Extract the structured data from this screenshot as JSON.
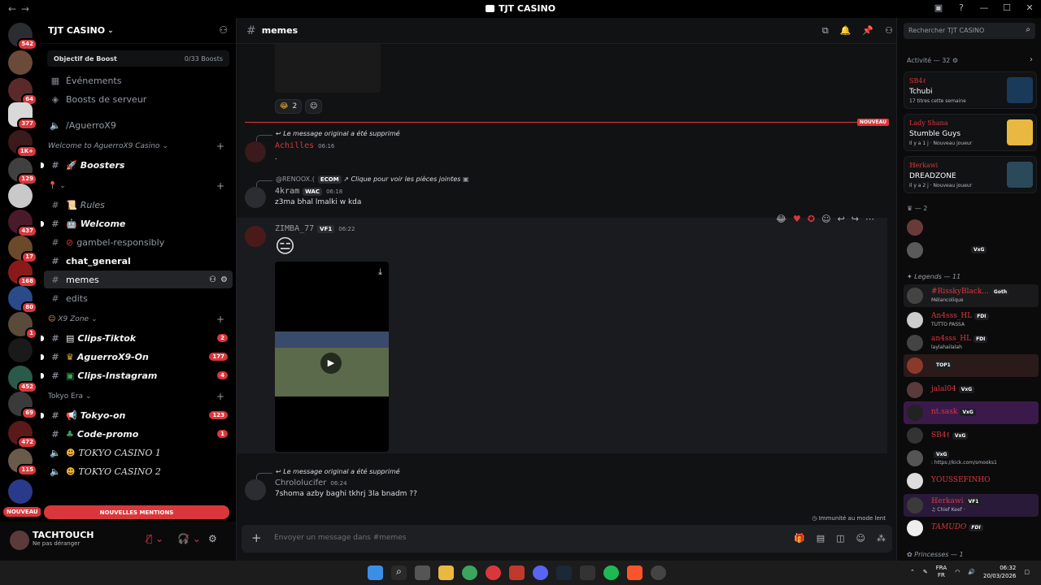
{
  "window": {
    "title": "TJT CASINO"
  },
  "rail": {
    "badges": [
      "542",
      "64",
      "377",
      "1K+",
      "129",
      "437",
      "17",
      "168",
      "80",
      "1",
      "452",
      "69",
      "472",
      "115"
    ],
    "new_label": "NOUVEAU"
  },
  "guild": {
    "name": "TJT CASINO",
    "boost_goal": "Objectif de Boost",
    "boost_count": "0/33 Boosts",
    "events": "Événements",
    "server_boosts": "Boosts de serveur",
    "channels": [
      {
        "label": "/AguerroX9",
        "kind": "voice"
      },
      {
        "label": "Welcome to AguerroX9 Casino",
        "kind": "category"
      },
      {
        "label": "Boosters",
        "kind": "text",
        "unread": true,
        "italic": true
      },
      {
        "label": "",
        "kind": "category"
      },
      {
        "label": "Rules",
        "kind": "text",
        "italic": true
      },
      {
        "label": "Welcome",
        "kind": "text",
        "unread": true,
        "italic": true
      },
      {
        "label": "gambel-responsibly",
        "kind": "text"
      },
      {
        "label": "chat_general",
        "kind": "text",
        "unread": true
      },
      {
        "label": "memes",
        "kind": "text",
        "active": true
      },
      {
        "label": "edits",
        "kind": "text"
      },
      {
        "label": "X9 Zone",
        "kind": "category"
      },
      {
        "label": "Clips-Tiktok",
        "kind": "text",
        "unread": true,
        "italic": true,
        "badge": "2"
      },
      {
        "label": "AguerroX9-On",
        "kind": "text",
        "unread": true,
        "italic": true,
        "badge": "177"
      },
      {
        "label": "Clips-Instagram",
        "kind": "text",
        "unread": true,
        "italic": true,
        "badge": "4"
      },
      {
        "label": "Tokyo Era",
        "kind": "category"
      },
      {
        "label": "Tokyo-on",
        "kind": "text",
        "unread": true,
        "italic": true,
        "badge": "123"
      },
      {
        "label": "Code-promo",
        "kind": "text",
        "unread": true,
        "italic": true,
        "badge": "1"
      },
      {
        "label": "TOKYO CASINO 1",
        "kind": "voice"
      },
      {
        "label": "TOKYO CASINO 2",
        "kind": "voice"
      }
    ],
    "mentions_label": "NOUVELLES MENTIONS"
  },
  "user": {
    "name": "TACHTOUCH",
    "status": "Ne pas déranger"
  },
  "channel": {
    "name": "memes",
    "search_placeholder": "Rechercher TJT CASINO",
    "composer_placeholder": "Envoyer un message dans #memes",
    "slow_mode": "Immunité au mode lent",
    "new_label": "NOUVEAU"
  },
  "messages": [
    {
      "reply": "Le message original a été supprimé",
      "author": "Achilles",
      "time": "06:16",
      "text": "."
    },
    {
      "reply_author": "@RENOOX.(",
      "reply_tag": "ECOM",
      "reply": "Clique pour voir les pièces jointes",
      "author": "4kram",
      "tag": "WAC",
      "time": "06:18",
      "text": "z3ma bhal lmalki w kda"
    },
    {
      "author": "ZIMBA_77",
      "tag": "VF1",
      "time": "06:22",
      "text": "😑"
    },
    {
      "reply": "Le message original a été supprimé",
      "author": "Chrololucifer",
      "time": "06:24",
      "text": "7shoma azby baghi tkhrj 3la bnadm ??"
    }
  ],
  "reaction_count": "2",
  "members": {
    "activity_header": "Activité — 32",
    "activities": [
      {
        "user": "SB4ℓ",
        "game": "Tchubi",
        "sub": "17 titres cette semaine"
      },
      {
        "user": "Lady Shana",
        "game": "Stumble Guys",
        "sub": "Il y a 1 j · Nouveau joueur"
      },
      {
        "user": "ℍerkawi",
        "game": "DREADZONE",
        "sub": "Il y a 2 j · Nouveau joueur"
      }
    ],
    "group_2": "— 2",
    "legends_header": "Legends — 11",
    "list": [
      {
        "name": "#RisskyBlack...",
        "tag": "Goth",
        "sub": "Mélancolique"
      },
      {
        "name": "An4sss_HL",
        "tag": "FDI",
        "sub": "TUTTO PASSA"
      },
      {
        "name": "an4sss_HL",
        "tag": "FDI",
        "sub": "laylahailalah"
      },
      {
        "name": "",
        "tag": "TOP1",
        "sub": ""
      },
      {
        "name": "jalal04",
        "tag": "VxG",
        "sub": ""
      },
      {
        "name": "nt.sask",
        "tag": "VxG",
        "sub": ""
      },
      {
        "name": "SB4ℓ",
        "tag": "VxG",
        "sub": ""
      },
      {
        "name": "",
        "tag": "VxG",
        "sub": ": https://kick.com/smooks1"
      },
      {
        "name": "YOUSSEFINHO",
        "tag": "",
        "sub": ""
      },
      {
        "name": "ℍerkawi",
        "tag": "VF1",
        "sub": "♫ Chief Keef ·"
      },
      {
        "name": "TAMUDO",
        "tag": "FDI",
        "sub": ""
      }
    ],
    "vxg_tag": "VxG",
    "princesses_header": "Princesses — 1"
  },
  "taskbar": {
    "lang1": "FRA",
    "lang2": "FR",
    "time": "06:32",
    "date": "20/03/2026"
  },
  "colors": {
    "accent_red": "#da373c",
    "bg": "#111214",
    "sidebar": "#000000"
  }
}
